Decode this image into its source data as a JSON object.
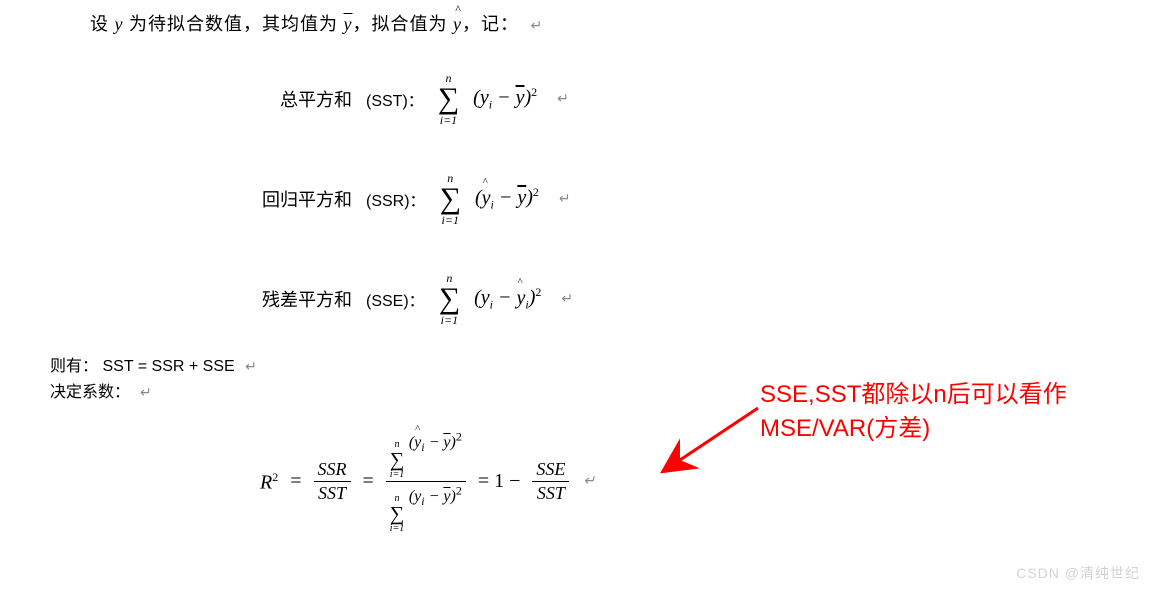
{
  "intro": "设 y 为待拟合数值，其均值为 ȳ，拟合值为 ŷ，记：",
  "eq_sst": {
    "label": "总平方和",
    "paren": "(SST)：",
    "sum_top": "n",
    "sum_bot": "i=1",
    "term": "(yᵢ − ȳ)²"
  },
  "eq_ssr": {
    "label": "回归平方和",
    "paren": "(SSR)：",
    "sum_top": "n",
    "sum_bot": "i=1",
    "term": "(ŷᵢ − ȳ)²"
  },
  "eq_sse": {
    "label": "残差平方和",
    "paren": "(SSE)：",
    "sum_top": "n",
    "sum_bot": "i=1",
    "term": "(yᵢ − ŷᵢ)²"
  },
  "note_identity": {
    "prefix": "则有：",
    "formula": "SST = SSR + SSE"
  },
  "note_coeff": "决定系数：",
  "r2": {
    "lhs": "R²",
    "frac1": {
      "num": "SSR",
      "den": "SST"
    },
    "frac2": {
      "num_sum_top": "n",
      "num_sum_bot": "i=1",
      "num_term": "(ŷᵢ − ȳ)²",
      "den_sum_top": "n",
      "den_sum_bot": "i=1",
      "den_term": "(yᵢ − ȳ)²"
    },
    "tail_prefix": "= 1 −",
    "frac3": {
      "num": "SSE",
      "den": "SST"
    }
  },
  "annotation": {
    "line1": "SSE,SST都除以n后可以看作",
    "line2": "MSE/VAR(方差)"
  },
  "return_mark": "↵",
  "watermark": "CSDN @清纯世纪"
}
